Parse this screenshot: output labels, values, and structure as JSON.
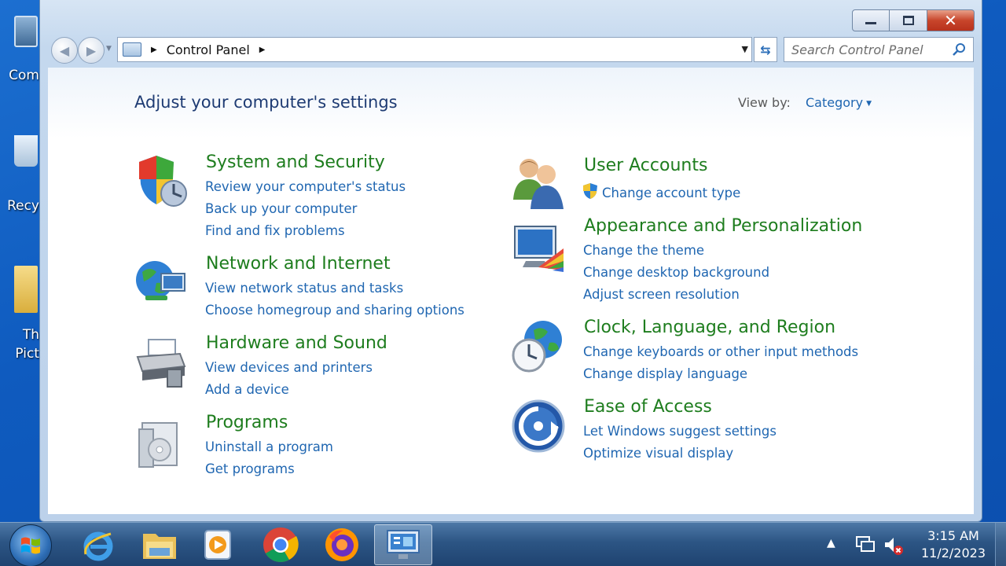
{
  "desktop": {
    "icons": [
      {
        "label": "Com"
      },
      {
        "label": "Recy"
      },
      {
        "label1": "Th",
        "label2": "Pict"
      }
    ]
  },
  "window": {
    "address": {
      "path": "Control Panel"
    },
    "search": {
      "placeholder": "Search Control Panel"
    },
    "heading": "Adjust your computer's settings",
    "view_by_label": "View by:",
    "view_by_value": "Category",
    "categories": [
      {
        "title": "System and Security",
        "links": [
          "Review your computer's status",
          "Back up your computer",
          "Find and fix problems"
        ]
      },
      {
        "title": "Network and Internet",
        "links": [
          "View network status and tasks",
          "Choose homegroup and sharing options"
        ]
      },
      {
        "title": "Hardware and Sound",
        "links": [
          "View devices and printers",
          "Add a device"
        ]
      },
      {
        "title": "Programs",
        "links": [
          "Uninstall a program",
          "Get programs"
        ]
      },
      {
        "title": "User Accounts",
        "links": [
          "Change account type"
        ]
      },
      {
        "title": "Appearance and Personalization",
        "links": [
          "Change the theme",
          "Change desktop background",
          "Adjust screen resolution"
        ]
      },
      {
        "title": "Clock, Language, and Region",
        "links": [
          "Change keyboards or other input methods",
          "Change display language"
        ]
      },
      {
        "title": "Ease of Access",
        "links": [
          "Let Windows suggest settings",
          "Optimize visual display"
        ]
      }
    ]
  },
  "taskbar": {
    "apps": [
      "internet-explorer-icon",
      "file-explorer-icon",
      "media-player-icon",
      "chrome-icon",
      "firefox-icon",
      "control-panel-icon"
    ],
    "clock": {
      "time": "3:15 AM",
      "date": "11/2/2023"
    }
  },
  "colors": {
    "title_green": "#1e7d1e",
    "link_blue": "#1f66b1",
    "heading_blue": "#1e3b73"
  }
}
